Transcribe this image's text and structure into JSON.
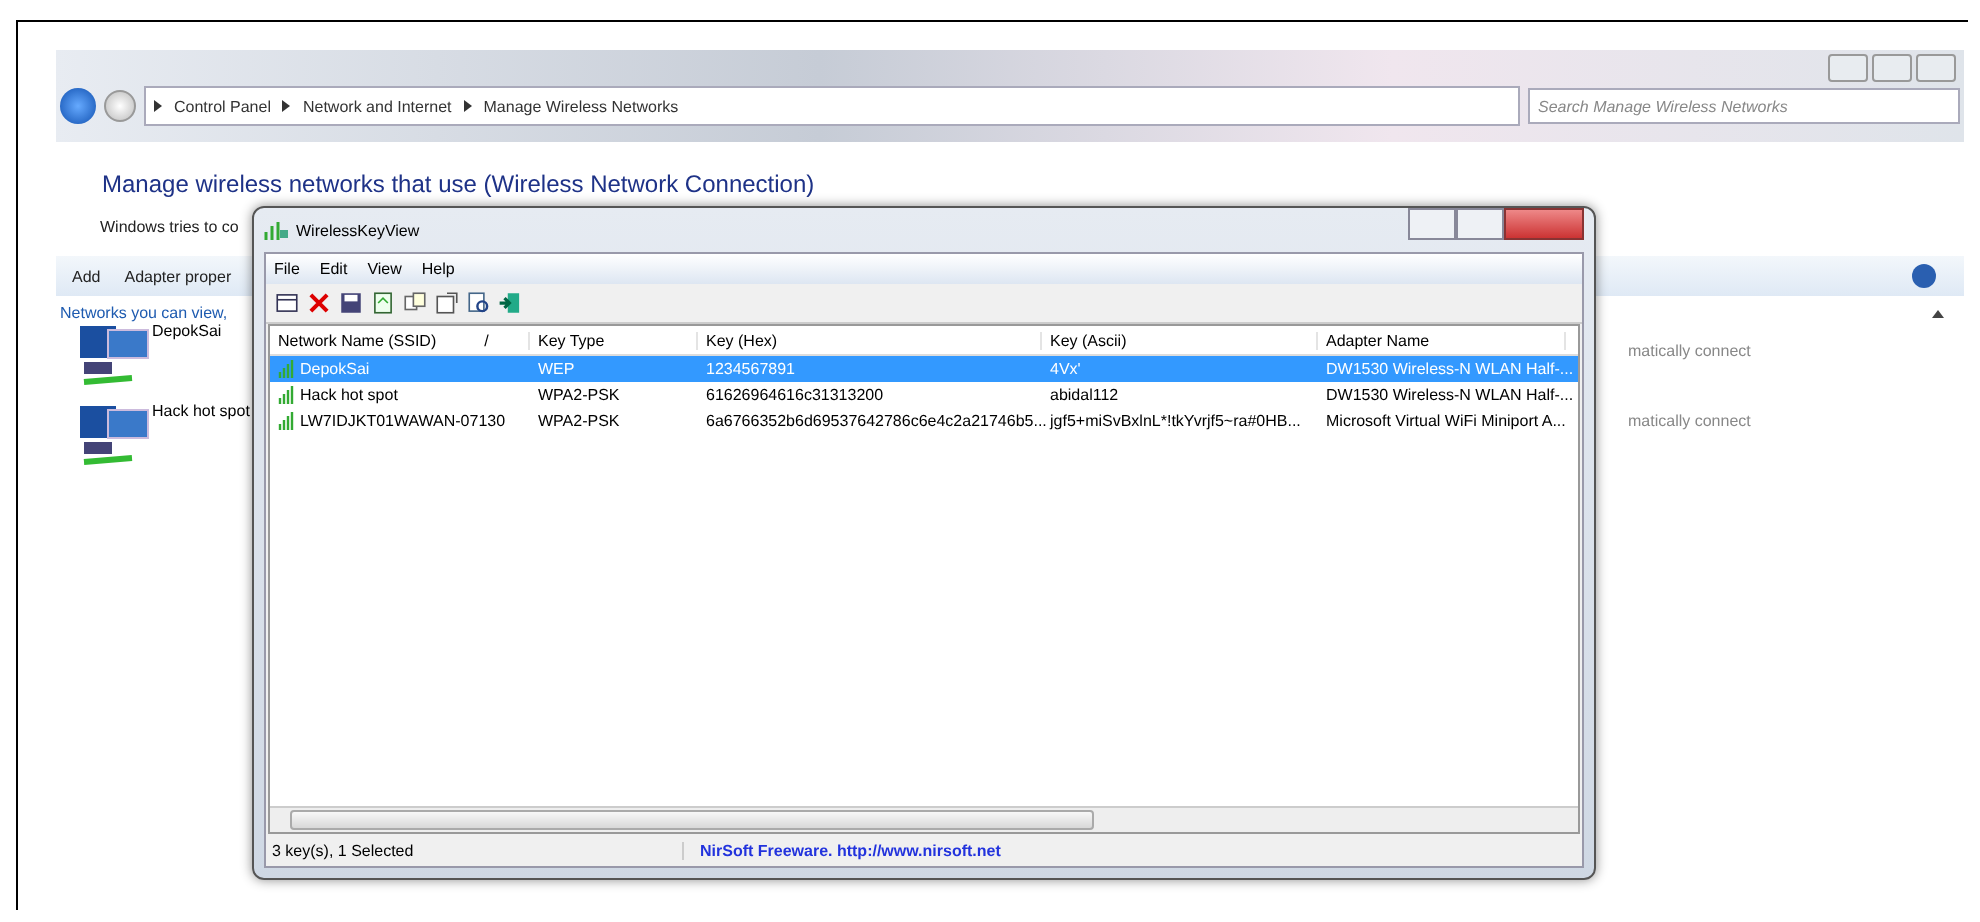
{
  "explorer": {
    "breadcrumb": [
      "Control Panel",
      "Network and Internet",
      "Manage Wireless Networks"
    ],
    "search": {
      "placeholder": "Search Manage Wireless Networks"
    },
    "heading": "Manage wireless networks that use (Wireless Network Connection)",
    "intro": "Windows tries to co",
    "toolbar": [
      "Add",
      "Adapter proper"
    ],
    "section": "Networks you can view,",
    "networks": [
      {
        "name": "DepokSai",
        "status": "matically connect"
      },
      {
        "name": "Hack hot spot",
        "status": "matically connect"
      }
    ]
  },
  "app": {
    "title": "WirelessKeyView",
    "menu": [
      "File",
      "Edit",
      "View",
      "Help"
    ],
    "columns": [
      "Network Name (SSID)",
      "Key Type",
      "Key (Hex)",
      "Key (Ascii)",
      "Adapter Name"
    ],
    "sort_mark": "/",
    "rows": [
      {
        "selected": true,
        "cells": [
          "DepokSai",
          "WEP",
          "1234567891",
          "4Vx'",
          "DW1530 Wireless-N WLAN Half-..."
        ]
      },
      {
        "selected": false,
        "cells": [
          "Hack hot spot",
          "WPA2-PSK",
          "61626964616c31313200",
          "abidal112",
          "DW1530 Wireless-N WLAN Half-..."
        ]
      },
      {
        "selected": false,
        "cells": [
          "LW7IDJKT01WAWAN-07130",
          "WPA2-PSK",
          "6a6766352b6d69537642786c6e4c2a21746b5...",
          "jgf5+miSvBxlnL*!tkYvrjf5~ra#0HB...",
          "Microsoft Virtual WiFi Miniport A..."
        ]
      }
    ],
    "status": "3 key(s), 1 Selected",
    "link": "NirSoft Freeware.  http://www.nirsoft.net"
  }
}
